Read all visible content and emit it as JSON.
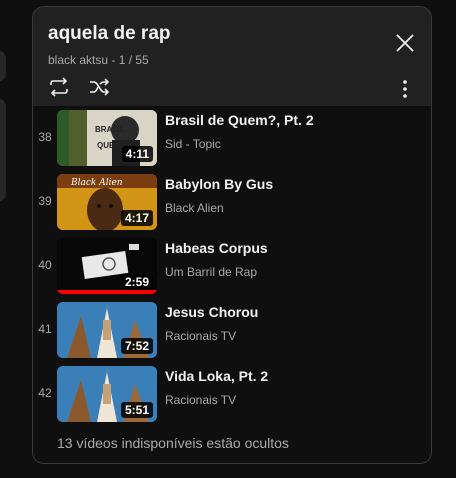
{
  "playlist": {
    "title": "aquela de rap",
    "subtitle": "black aktsu - 1 / 55"
  },
  "controls": {
    "loop_icon": "loop-icon",
    "shuffle_icon": "shuffle-icon",
    "more_icon": "more-vertical-icon",
    "close_icon": "close-icon"
  },
  "items": [
    {
      "index": "38",
      "title": "Brasil de Quem?, Pt. 2",
      "channel": "Sid - Topic",
      "duration": "4:11"
    },
    {
      "index": "39",
      "title": "Babylon By Gus",
      "channel": "Black Alien",
      "duration": "4:17"
    },
    {
      "index": "40",
      "title": "Habeas Corpus",
      "channel": "Um Barril de Rap",
      "duration": "2:59",
      "watched_progress": 1.0
    },
    {
      "index": "41",
      "title": "Jesus Chorou",
      "channel": "Racionais TV",
      "duration": "7:52"
    },
    {
      "index": "42",
      "title": "Vida Loka, Pt. 2",
      "channel": "Racionais TV",
      "duration": "5:51"
    }
  ],
  "footer": {
    "hidden_notice": "13 vídeos indisponíveis estão ocultos"
  },
  "colors": {
    "panel_bg": "#212121",
    "list_bg": "#0f0f0f",
    "secondary_text": "#aaaaaa",
    "progress_red": "#ff0000"
  }
}
